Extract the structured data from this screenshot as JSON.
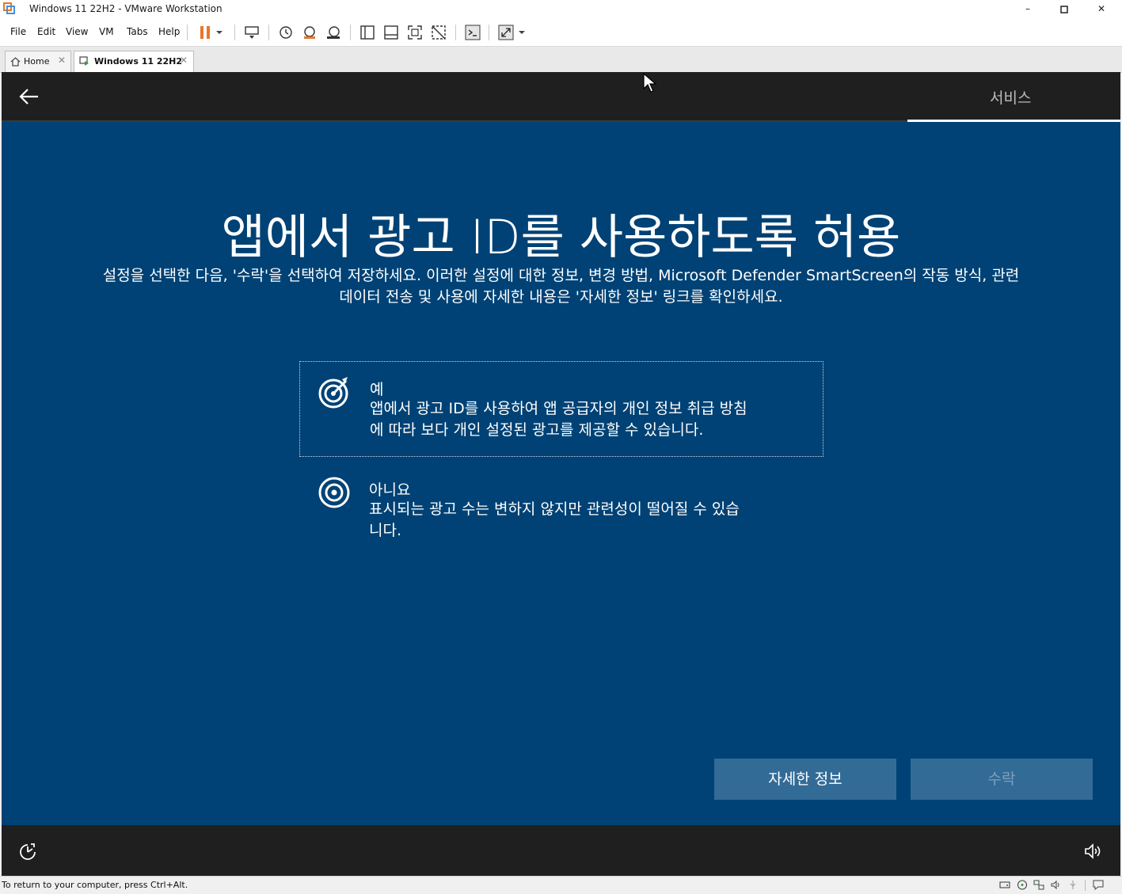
{
  "window": {
    "title": "Windows 11 22H2 - VMware Workstation",
    "minimize": "–",
    "maximize": "□",
    "close": "✕"
  },
  "menu": [
    "File",
    "Edit",
    "View",
    "VM",
    "Tabs",
    "Help"
  ],
  "tabs": [
    {
      "label": "Home",
      "close": "✕"
    },
    {
      "label": "Windows 11 22H2",
      "close": "✕"
    }
  ],
  "oobe": {
    "section": "서비스",
    "heading": "앱에서 광고 ID를 사용하도록 허용",
    "description_line1": "설정을 선택한 다음, '수락'을 선택하여 저장하세요. 이러한 설정에 대한 정보, 변경 방법, Microsoft Defender SmartScreen의 작동 방식, 관련",
    "description_line2": "데이터 전송 및 사용에 자세한 내용은 '자세한 정보' 링크를 확인하세요.",
    "options": [
      {
        "title": "예",
        "line1": "앱에서 광고 ID를 사용하여 앱 공급자의 개인 정보 취급 방침",
        "line2": "에 따라 보다 개인 설정된 광고를 제공할 수 있습니다."
      },
      {
        "title": "아니요",
        "line1": "표시되는 광고 수는 변하지 않지만 관련성이 떨어질 수 있습",
        "line2": "니다."
      }
    ],
    "learn_more": "자세한 정보",
    "accept": "수락"
  },
  "status": {
    "message": "To return to your computer, press Ctrl+Alt."
  },
  "colors": {
    "vm_background": "#004275",
    "strip": "#1f1f1f",
    "button": "#336b97",
    "accent_orange": "#e8762b"
  }
}
